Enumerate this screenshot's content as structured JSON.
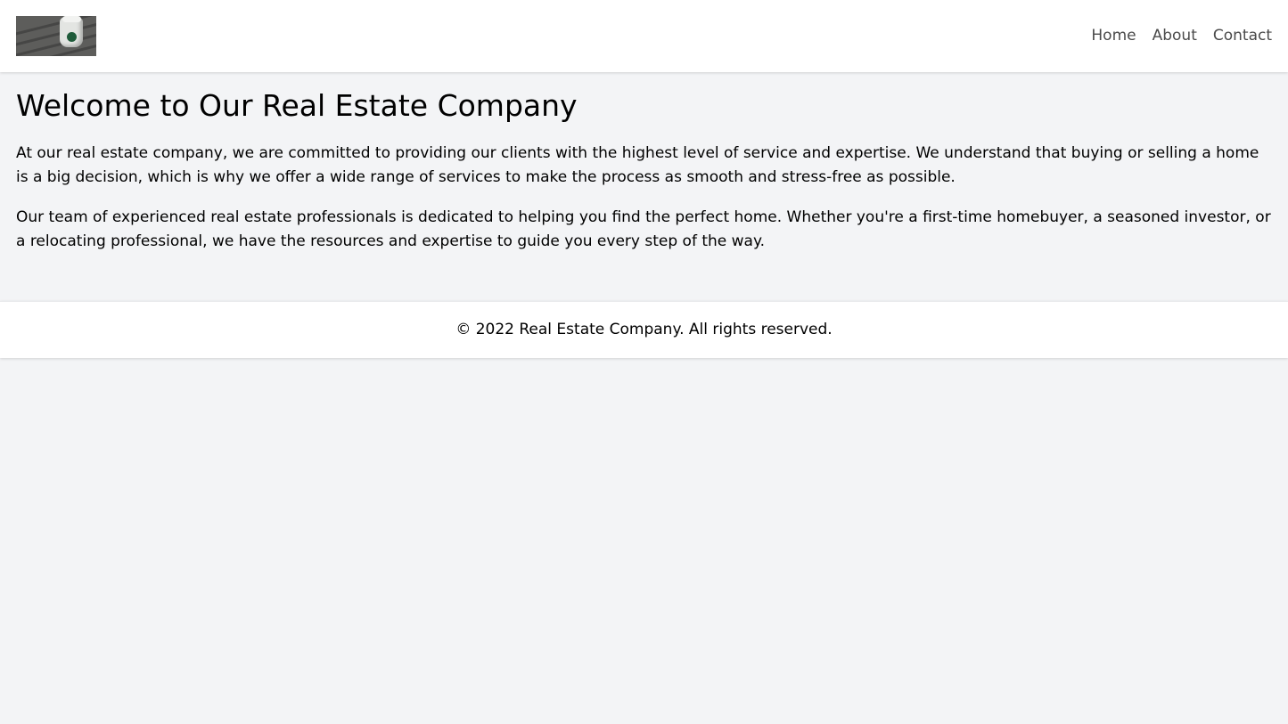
{
  "header": {
    "logo": {
      "icon": "coffee-cup-photo",
      "alt": ""
    },
    "nav": [
      {
        "label": "Home"
      },
      {
        "label": "About"
      },
      {
        "label": "Contact"
      }
    ]
  },
  "main": {
    "title": "Welcome to Our Real Estate Company",
    "paragraphs": [
      "At our real estate company, we are committed to providing our clients with the highest level of service and expertise. We understand that buying or selling a home is a big decision, which is why we offer a wide range of services to make the process as smooth and stress-free as possible.",
      "Our team of experienced real estate professionals is dedicated to helping you find the perfect home. Whether you're a first-time homebuyer, a seasoned investor, or a relocating professional, we have the resources and expertise to guide you every step of the way."
    ]
  },
  "footer": {
    "text": "© 2022 Real Estate Company. All rights reserved."
  },
  "colors": {
    "page_background": "#f3f4f6",
    "header_background": "#ffffff",
    "nav_text": "#4b4b4b",
    "body_text": "#000000"
  }
}
